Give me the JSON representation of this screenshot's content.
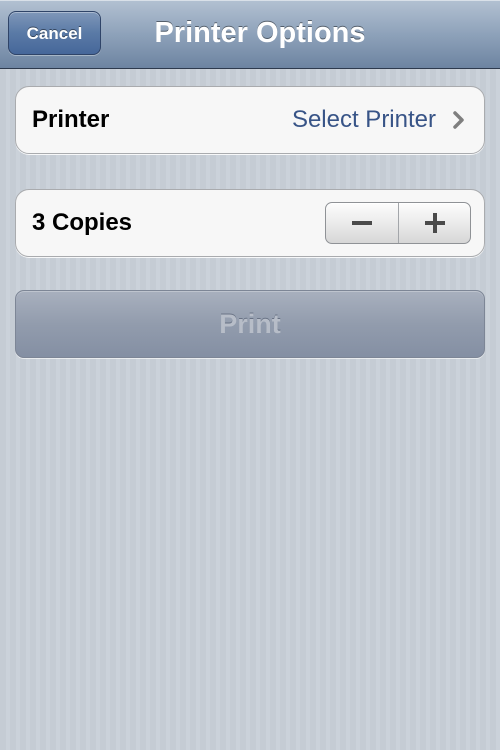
{
  "navbar": {
    "title": "Printer Options",
    "cancel_label": "Cancel"
  },
  "printer_row": {
    "label": "Printer",
    "value": "Select Printer",
    "accessory_icon": "chevron-right-icon"
  },
  "copies_row": {
    "label": "3 Copies",
    "count": 3,
    "decrement_icon": "minus-icon",
    "increment_icon": "plus-icon"
  },
  "print_button": {
    "label": "Print",
    "enabled": false
  },
  "colors": {
    "navbar": "#8ea2ba",
    "cancel_button": "#5a7aa6",
    "value_text": "#385487",
    "background": "#c5ccd4",
    "print_button_disabled": "#929cad"
  }
}
